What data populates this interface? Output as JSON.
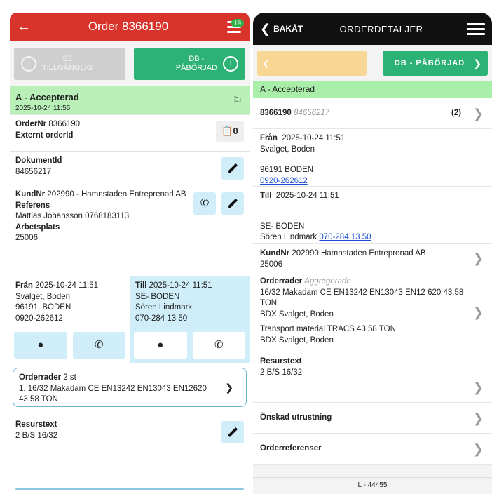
{
  "left": {
    "title": "Order 8366190",
    "badge_count": "19",
    "buttons": {
      "unavailable": "EJ\nTILLGÄNGLIG",
      "started": "DB -\nPÅBÖRJAD"
    },
    "status": {
      "label": "A - Accepterad",
      "datetime": "2025-10-24 11:55"
    },
    "order": {
      "ordernr_label": "OrderNr",
      "ordernr": "8366190",
      "external_label": "Externt orderId",
      "attachments": "0"
    },
    "document": {
      "label": "DokumentId",
      "value": "84656217"
    },
    "customer": {
      "kundnr_label": "KundNr",
      "kundnr": "202990 - Hamnstaden Entreprenad AB",
      "ref_label": "Referens",
      "ref_value": "Mattias Johansson 0768183113",
      "workplace_label": "Arbetsplats",
      "workplace_value": "25006"
    },
    "from": {
      "label": "Från",
      "datetime": "2025-10-24 11:51",
      "line1": "Svalget, Boden",
      "line2": "96191, BODEN",
      "line3": "0920-262612"
    },
    "to": {
      "label": "Till",
      "datetime": "2025-10-24 11:51",
      "line1": "SE- BODEN",
      "line2": "Sören Lindmark",
      "line3": "070-284 13 50"
    },
    "orderrows": {
      "label": "Orderrader",
      "count": "2 st",
      "text": "1. 16/32 Makadam CE EN13242 EN13043 EN12620 43,58 TON"
    },
    "resource": {
      "label": "Resurstext",
      "value": "2 B/S 16/32"
    }
  },
  "right": {
    "back_label": "BAKÅT",
    "title": "ORDERDETALJER",
    "next_button": "DB - PÅBÖRJAD",
    "status": "A - Accepterad",
    "order_id": "8366190",
    "doc_id": "84656217",
    "count": "(2)",
    "from": {
      "label": "Från",
      "datetime": "2025-10-24 11:51",
      "line1": "Svalget, Boden",
      "line2": "96191 BODEN",
      "phone": "0920-262612"
    },
    "to": {
      "label": "Till",
      "datetime": "2025-10-24 11:51",
      "line1": "SE- BODEN",
      "contact": "Sören Lindmark",
      "phone": "070-284 13 50"
    },
    "kund": {
      "label": "KundNr",
      "value": "202990 Hamnstaden Entreprenad AB",
      "line2": "25006"
    },
    "orderrows": {
      "label": "Orderrader",
      "sub": "Aggregerade",
      "row1": "16/32 Makadam CE EN13242 EN13043 EN12 620 43.58 TON",
      "row1b": "BDX Svalget, Boden",
      "row2": "Transport material TRACS 43.58 TON",
      "row2b": "BDX Svalget, Boden"
    },
    "resource": {
      "label": "Resurstext",
      "value": "2 B/S 16/32"
    },
    "equipment": "Önskad utrustning",
    "references": "Orderreferenser",
    "footer": "L - 44455"
  }
}
